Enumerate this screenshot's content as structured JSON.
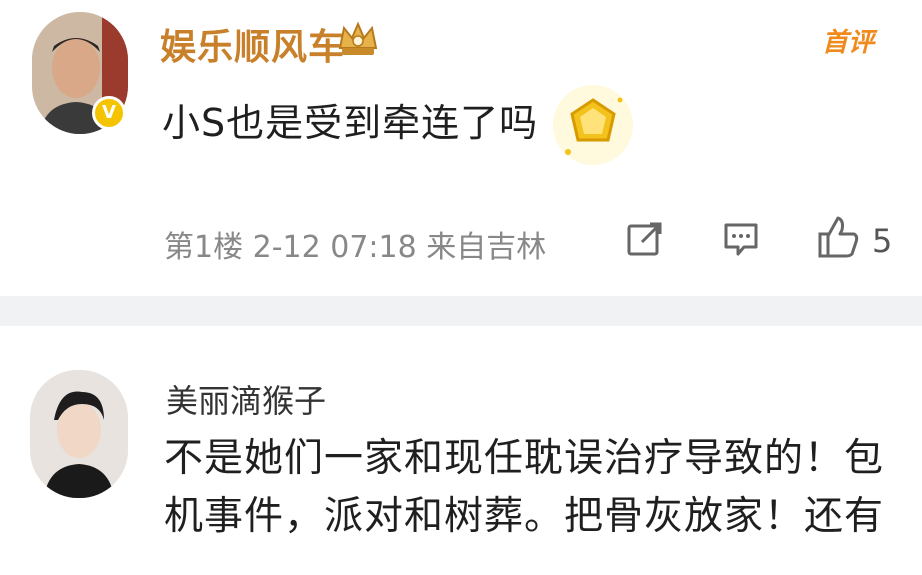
{
  "comment1": {
    "username": "娱乐顺风车",
    "author_tag": "首评",
    "verified_mark": "V",
    "content": "小S也是受到牵连了吗",
    "meta": "第1楼 2-12 07:18 来自吉林",
    "like_count": "5",
    "icons": [
      "share-icon",
      "comment-icon",
      "like-icon",
      "crown-icon",
      "badge-sticker-icon"
    ]
  },
  "comment2": {
    "username": "美丽滴猴子",
    "content": "不是她们一家和现任耽误治疗导致的！包机事件，派对和树葬。把骨灰放家！还有"
  },
  "colors": {
    "username1": "#c8812a",
    "author_tag": "#f08a1c",
    "verified_badge": "#f5c400",
    "divider": "#f1f2f4"
  }
}
